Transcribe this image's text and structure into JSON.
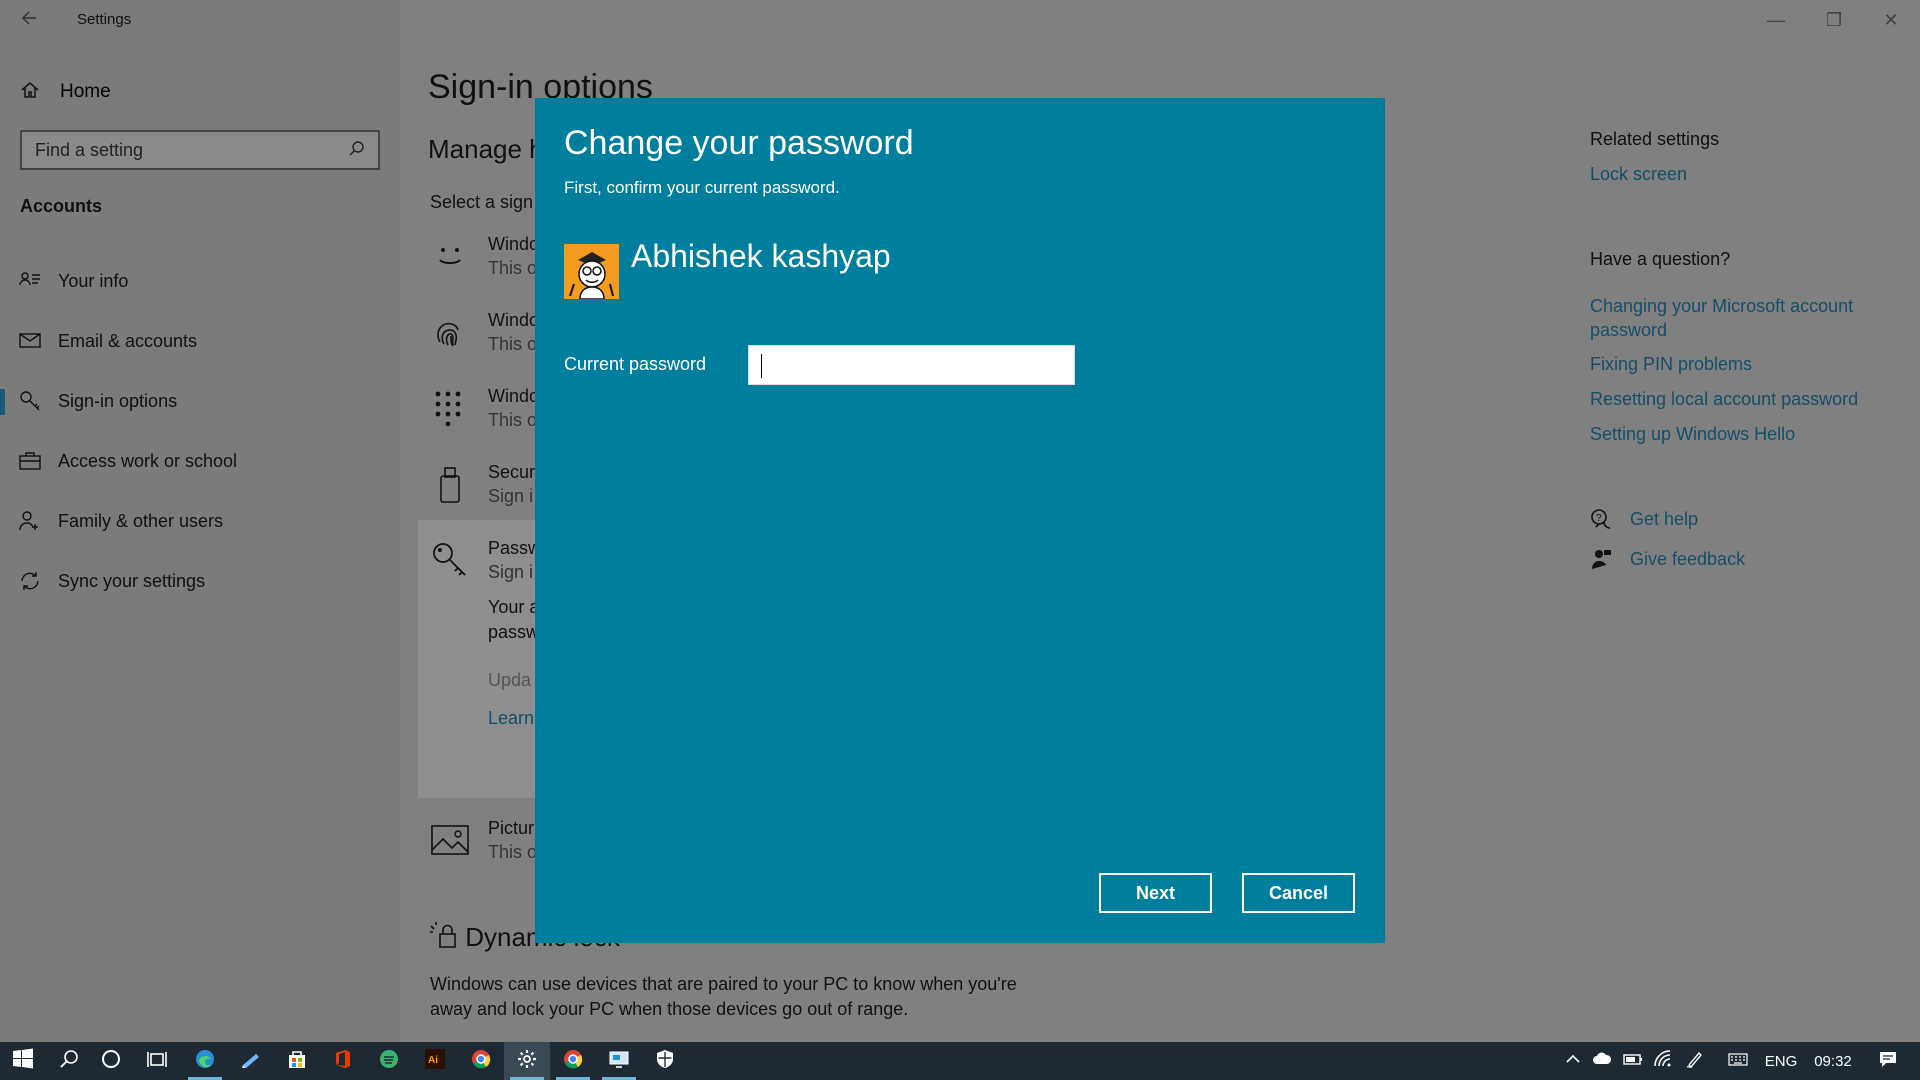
{
  "window": {
    "title": "Settings"
  },
  "sidebar": {
    "home_label": "Home",
    "search_placeholder": "Find a setting",
    "section": "Accounts",
    "items": [
      {
        "label": "Your info",
        "icon": "person-list-icon"
      },
      {
        "label": "Email & accounts",
        "icon": "mail-icon"
      },
      {
        "label": "Sign-in options",
        "icon": "key-icon"
      },
      {
        "label": "Access work or school",
        "icon": "briefcase-icon"
      },
      {
        "label": "Family & other users",
        "icon": "person-add-icon"
      },
      {
        "label": "Sync your settings",
        "icon": "sync-icon"
      }
    ],
    "active_index": 2
  },
  "main": {
    "title": "Sign-in options",
    "subtitle": "Manage h",
    "select_text": "Select a sign",
    "options": [
      {
        "title": "Windo",
        "sub": "This o",
        "icon": "face-icon"
      },
      {
        "title": "Windo",
        "sub": "This o",
        "icon": "fingerprint-icon"
      },
      {
        "title": "Windo",
        "sub": "This o",
        "icon": "pin-keypad-icon"
      },
      {
        "title": "Secur",
        "sub": "Sign i",
        "icon": "security-key-icon"
      },
      {
        "title": "Passw",
        "sub": "Sign i",
        "icon": "password-key-icon"
      },
      {
        "title": "Pictur",
        "sub": "This o",
        "icon": "picture-icon"
      }
    ],
    "password_extra": {
      "line1": "Your a",
      "line2": "passw",
      "update": "Upda",
      "learn": "Learn"
    },
    "dynamic_lock_title": "Dynamic lock",
    "dynamic_lock_desc": "Windows can use devices that are paired to your PC to know when you're away and lock your PC when those devices go out of range."
  },
  "related": {
    "heading": "Related settings",
    "lock_screen": "Lock screen",
    "question_heading": "Have a question?",
    "links": [
      "Changing your Microsoft account password",
      "Fixing PIN problems",
      "Resetting local account password",
      "Setting up Windows Hello"
    ],
    "get_help": "Get help",
    "give_feedback": "Give feedback"
  },
  "dialog": {
    "title": "Change your password",
    "subtitle": "First, confirm your current password.",
    "username": "Abhishek kashyap",
    "password_label": "Current password",
    "password_value": "",
    "next_label": "Next",
    "cancel_label": "Cancel",
    "accent_color": "#007e9e"
  },
  "taskbar": {
    "language": "ENG",
    "time": "09:32"
  }
}
